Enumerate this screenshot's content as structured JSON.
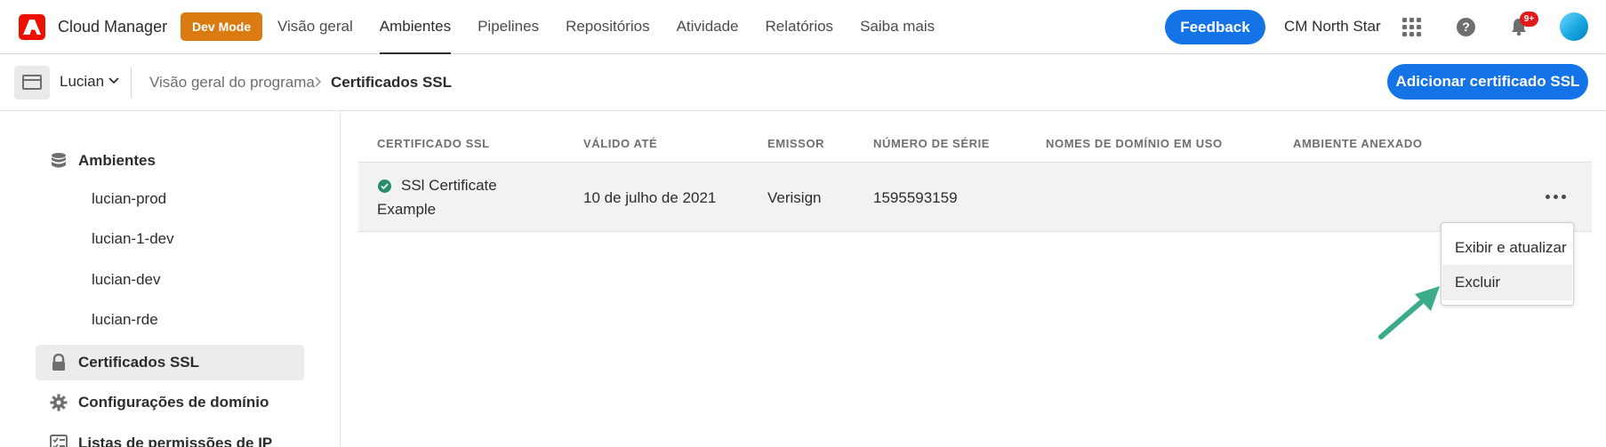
{
  "topbar": {
    "app_title": "Cloud Manager",
    "dev_mode": "Dev Mode",
    "nav": [
      "Visão geral",
      "Ambientes",
      "Pipelines",
      "Repositórios",
      "Atividade",
      "Relatórios",
      "Saiba mais"
    ],
    "active_nav": "Ambientes",
    "feedback_label": "Feedback",
    "org_name": "CM North Star",
    "notification_badge": "9+"
  },
  "subbar": {
    "program_name": "Lucian",
    "breadcrumb_parent": "Visão geral do programa",
    "breadcrumb_current": "Certificados SSL",
    "add_button": "Adicionar certificado SSL"
  },
  "sidebar": {
    "environments_label": "Ambientes",
    "environments": [
      "lucian-prod",
      "lucian-1-dev",
      "lucian-dev",
      "lucian-rde"
    ],
    "ssl_label": "Certificados SSL",
    "domain_label": "Configurações de domínio",
    "ip_label": "Listas de permissões de IP"
  },
  "table": {
    "headers": [
      "CERTIFICADO SSL",
      "VÁLIDO ATÉ",
      "EMISSOR",
      "NÚMERO DE SÉRIE",
      "NOMES DE DOMÍNIO EM USO",
      "AMBIENTE ANEXADO"
    ],
    "row": {
      "name_line1": "SSl Certificate",
      "name_line2": "Example",
      "valid_until": "10 de julho de 2021",
      "issuer": "Verisign",
      "serial": "1595593159"
    }
  },
  "menu": {
    "items": [
      "Exibir e atualizar",
      "Excluir"
    ],
    "highlighted": "Excluir"
  },
  "colors": {
    "accent_blue": "#1473e6",
    "dev_mode_orange": "#da7b11",
    "adobe_red": "#eb1000",
    "success_green": "#268e6c",
    "arrow_teal": "#3bab8c"
  }
}
